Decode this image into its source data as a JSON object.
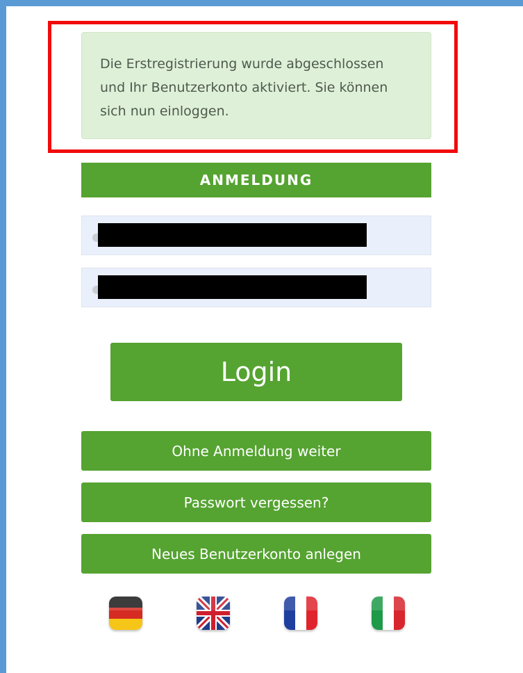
{
  "alert": {
    "line1": "Die Erstregistrierung wurde abgeschlossen",
    "line2": "und Ihr Benutzerkonto aktiviert. Sie können",
    "line3": "sich nun einloggen."
  },
  "login_section": {
    "header": "ANMELDUNG"
  },
  "form": {
    "username_value": "",
    "password_value": ""
  },
  "buttons": {
    "login": "Login",
    "guest": "Ohne Anmeldung weiter",
    "forgot_password": "Passwort vergessen?",
    "register": "Neues Benutzerkonto anlegen"
  },
  "languages": [
    "de-flag-icon",
    "uk-flag-icon",
    "fr-flag-icon",
    "it-flag-icon"
  ],
  "colors": {
    "accent_green": "#55a331",
    "alert_bg": "#dff0d8",
    "highlight_red": "#f10b0b",
    "frame_blue": "#5b9bd5"
  }
}
